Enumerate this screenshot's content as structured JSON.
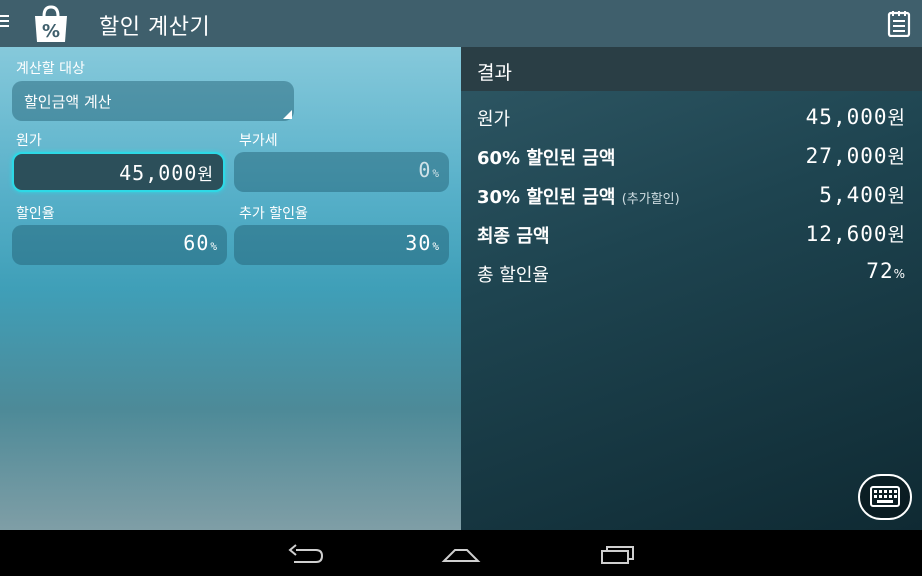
{
  "app": {
    "title": "할인 계산기"
  },
  "icons": {
    "menu": "menu-icon",
    "app": "shopping-bag-percent-icon",
    "notes": "notes-icon",
    "keyboard": "keyboard-icon",
    "back": "back-icon",
    "home": "home-icon",
    "recents": "recents-icon"
  },
  "form": {
    "target_label": "계산할 대상",
    "target_value": "할인금액 계산",
    "price_label": "원가",
    "price_value": "45,000",
    "price_unit": "원",
    "vat_label": "부가세",
    "vat_value": "0",
    "vat_unit": "%",
    "rate_label": "할인율",
    "rate_value": "60",
    "rate_unit": "%",
    "extra_label": "추가 할인율",
    "extra_value": "30",
    "extra_unit": "%"
  },
  "result": {
    "title": "결과",
    "rows": [
      {
        "label": "원가",
        "sub": "",
        "value": "45,000",
        "unit": "원"
      },
      {
        "label": "60% 할인된 금액",
        "sub": "",
        "value": "27,000",
        "unit": "원"
      },
      {
        "label": "30% 할인된 금액",
        "sub": "(추가할인)",
        "value": "5,400",
        "unit": "원"
      },
      {
        "label": "최종 금액",
        "sub": "",
        "value": "12,600",
        "unit": "원"
      },
      {
        "label": "총 할인율",
        "sub": "",
        "value": "72",
        "unit": "%"
      }
    ]
  },
  "colors": {
    "actionbar": "#3f5f6c",
    "active_border": "#2dd9e6",
    "result_header": "#2a3e45"
  }
}
